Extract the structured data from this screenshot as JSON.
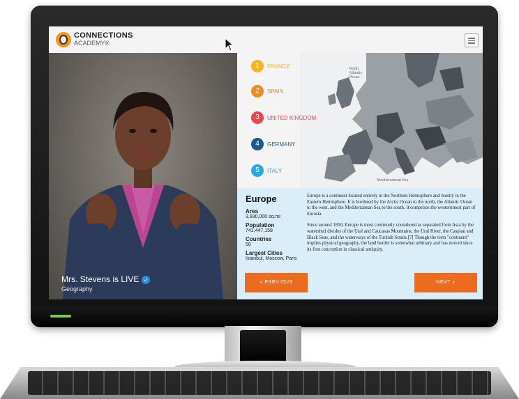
{
  "brand": {
    "line1": "CONNECTIONS",
    "line2": "ACADEMY®",
    "accent": "#ec6c1f"
  },
  "video": {
    "live_label": "Mrs. Stevens is LIVE",
    "subtitle": "Geography",
    "verified_icon": "check-badge-icon"
  },
  "map": {
    "ocean_label": "North\nAtlantic\nOcean",
    "sea_label": "Mediterranean Sea"
  },
  "countries": [
    {
      "num": "1",
      "name": "FRANCE",
      "color": "#f5b51d"
    },
    {
      "num": "2",
      "name": "SPAIN",
      "color": "#f18a1e"
    },
    {
      "num": "3",
      "name": "UNITED KINGDOM",
      "color": "#e6484f"
    },
    {
      "num": "4",
      "name": "GERMANY",
      "color": "#1d5a8c"
    },
    {
      "num": "5",
      "name": "ITALY",
      "color": "#27a9e1"
    }
  ],
  "info": {
    "title": "Europe",
    "area_label": "Area",
    "area_value": "3,930,000 sq.mi",
    "population_label": "Population",
    "population_value": "741,447,158",
    "countries_label": "Countries",
    "countries_value": "50",
    "cities_label": "Largest Cities",
    "cities_value": "Istanbul, Moscow, Paris",
    "para1": "Europe is a continent located entirely in the Northern Hemisphere and mostly in the Eastern Hemisphere. It is bordered by the Arctic Ocean to the north, the Atlantic Ocean to the west, and the Mediterranean Sea to the south. It comprises the westernmost part of Eurasia.",
    "para2": "Since around 1850, Europe is most commonly considered as separated from Asia by the watershed divides of the Ural and Caucasus Mountains, the Ural River, the Caspian and Black Seas, and the waterways of the Turkish Straits.[7] Though the term \"continent\" implies physical geography, the land border is somewhat arbitrary and has moved since its first conception in classical antiquity."
  },
  "buttons": {
    "previous": "« PREVIOUS",
    "next": "NEXT »"
  }
}
